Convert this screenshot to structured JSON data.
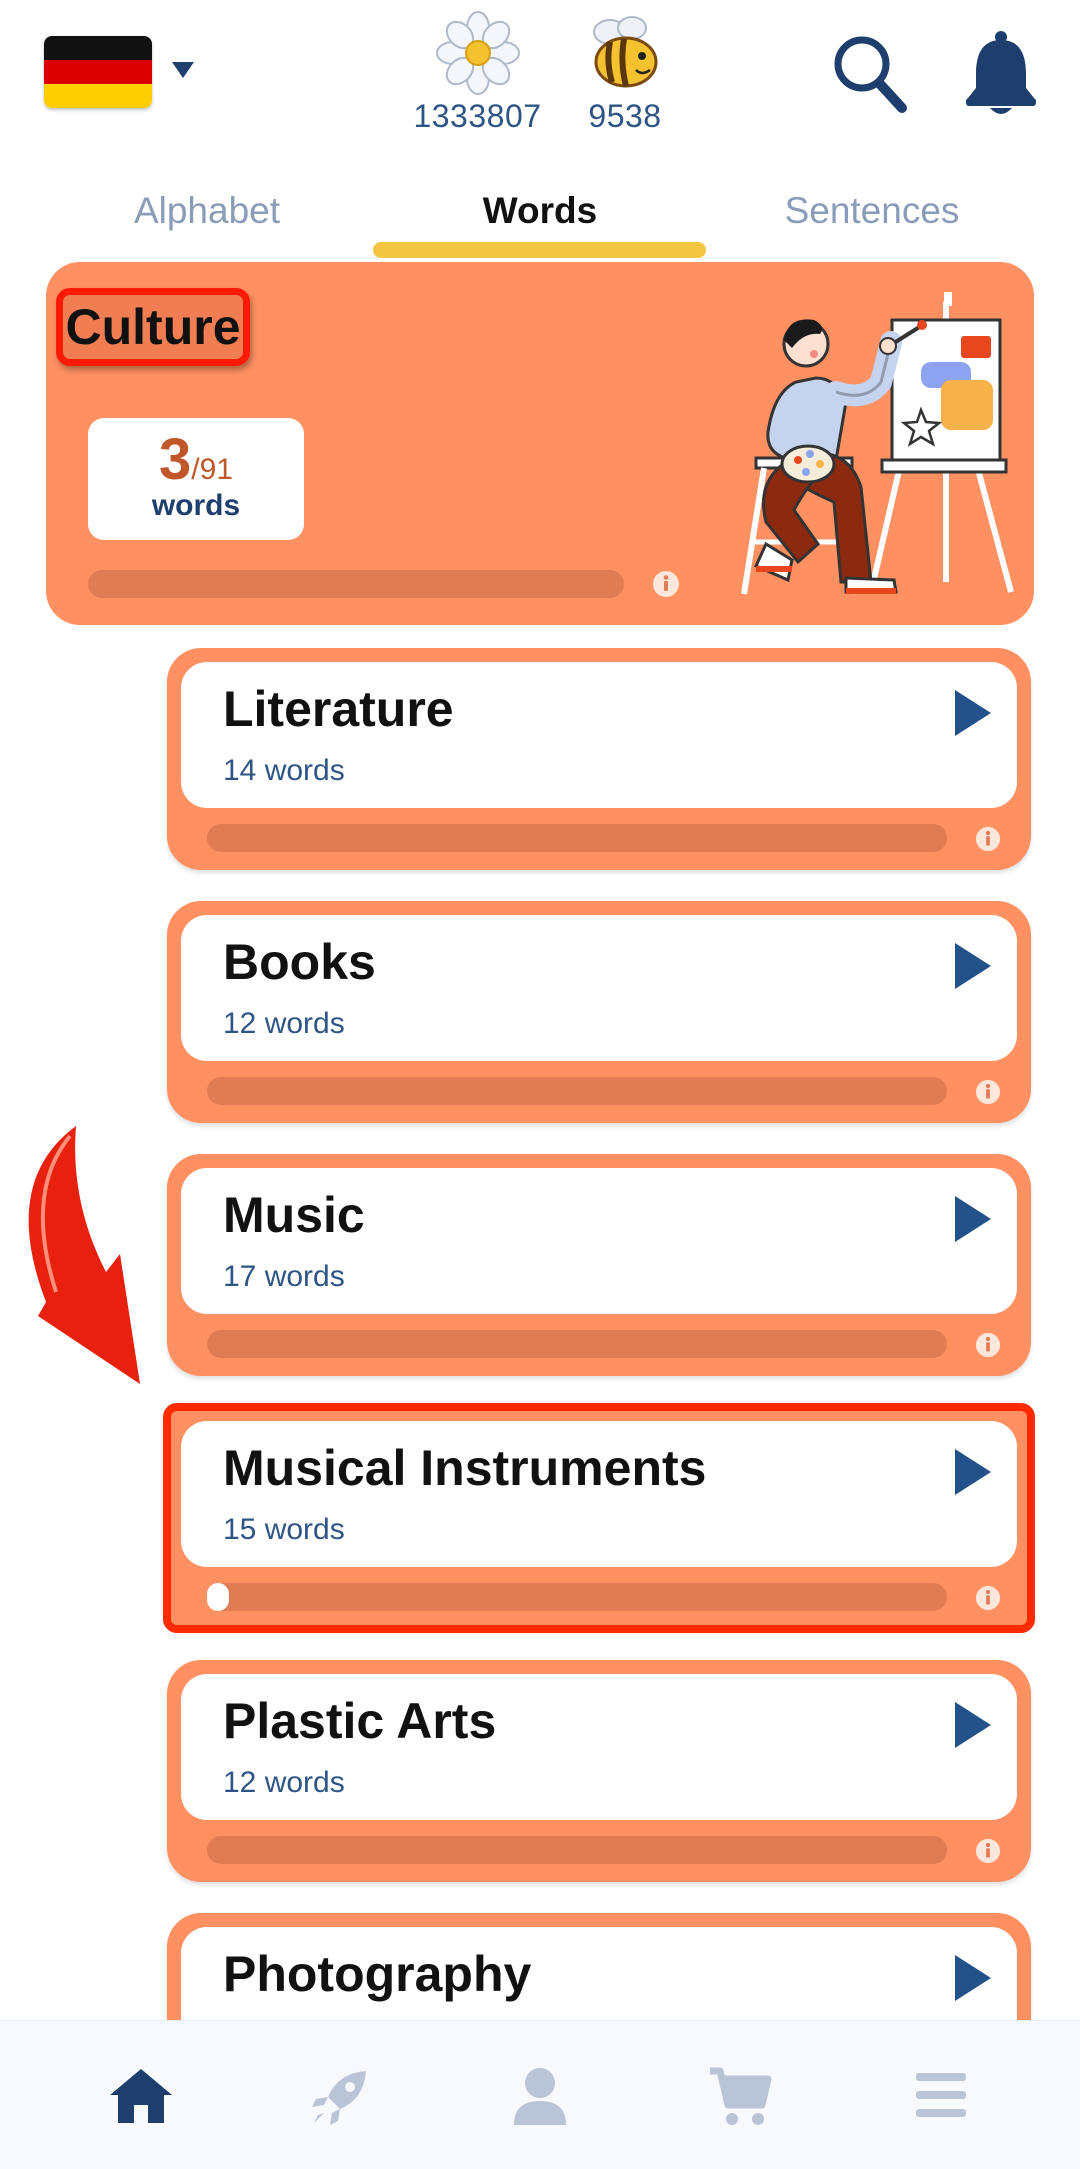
{
  "header": {
    "language_flag": "germany-flag",
    "flowers_count": "1333807",
    "bees_count": "9538"
  },
  "tabs": [
    {
      "label": "Alphabet",
      "active": false
    },
    {
      "label": "Words",
      "active": true
    },
    {
      "label": "Sentences",
      "active": false
    }
  ],
  "category": {
    "title": "Culture",
    "learned": "3",
    "total": "/91",
    "unit": "words",
    "progress": 0
  },
  "topics": [
    {
      "name": "Literature",
      "count": "14 words",
      "progress": 0
    },
    {
      "name": "Books",
      "count": "12 words",
      "progress": 0
    },
    {
      "name": "Music",
      "count": "17 words",
      "progress": 0
    },
    {
      "name": "Musical Instruments",
      "count": "15 words",
      "progress": 0.03,
      "highlighted": true
    },
    {
      "name": "Plastic Arts",
      "count": "12 words",
      "progress": 0
    },
    {
      "name": "Photography",
      "count": "",
      "progress": 0
    }
  ],
  "bottom_nav": [
    "home-icon",
    "rocket-icon",
    "profile-icon",
    "cart-icon",
    "menu-icon"
  ],
  "colors": {
    "card": "#fe9062",
    "accent_navy": "#23518a",
    "tab_underline": "#f2c640",
    "highlight_red": "#ff2a00"
  }
}
